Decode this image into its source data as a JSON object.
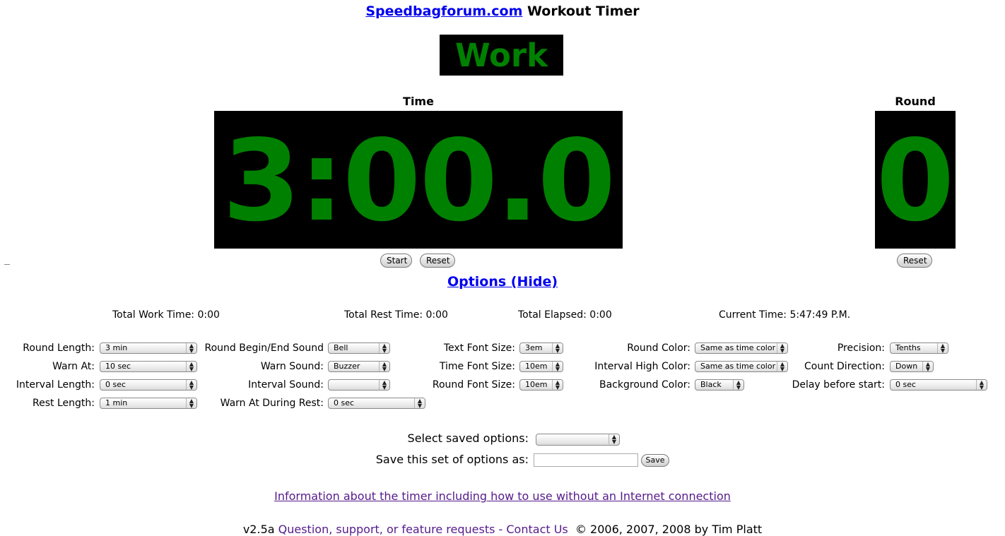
{
  "header": {
    "site_link": "Speedbagforum.com",
    "title_rest": " Workout Timer"
  },
  "mode_label": "Work",
  "time": {
    "heading": "Time",
    "value": "3:00.0",
    "start_label": "Start",
    "reset_label": "Reset"
  },
  "round": {
    "heading": "Round",
    "value": "0",
    "reset_label": "Reset"
  },
  "colors": {
    "display_bg": "#000000",
    "display_fg": "#008000",
    "link": "#0000ee",
    "visited_link": "#551a8b"
  },
  "options_link": "Options (Hide)",
  "stats": {
    "total_work": "Total Work Time: 0:00",
    "total_rest": "Total Rest Time: 0:00",
    "total_elapsed": "Total Elapsed: 0:00",
    "current_time": "Current Time: 5:47:49 P.M."
  },
  "options": {
    "round_length": {
      "label": "Round Length:",
      "value": "3 min"
    },
    "warn_at": {
      "label": "Warn At:",
      "value": "10 sec"
    },
    "interval_length": {
      "label": "Interval Length:",
      "value": "0 sec"
    },
    "rest_length": {
      "label": "Rest Length:",
      "value": "1 min"
    },
    "round_sound": {
      "label": "Round Begin/End Sound",
      "value": "Bell"
    },
    "warn_sound": {
      "label": "Warn Sound:",
      "value": "Buzzer"
    },
    "interval_sound": {
      "label": "Interval Sound:",
      "value": ""
    },
    "warn_during_rest": {
      "label": "Warn At During Rest:",
      "value": "0 sec"
    },
    "text_font_size": {
      "label": "Text Font Size:",
      "value": "3em"
    },
    "time_font_size": {
      "label": "Time Font Size:",
      "value": "10em"
    },
    "round_font_size": {
      "label": "Round Font Size:",
      "value": "10em"
    },
    "round_color": {
      "label": "Round Color:",
      "value": "Same as time color"
    },
    "interval_high_color": {
      "label": "Interval High Color:",
      "value": "Same as time color"
    },
    "background_color": {
      "label": "Background Color:",
      "value": "Black"
    },
    "precision": {
      "label": "Precision:",
      "value": "Tenths"
    },
    "count_direction": {
      "label": "Count Direction:",
      "value": "Down"
    },
    "delay_before_start": {
      "label": "Delay before start:",
      "value": "0 sec"
    }
  },
  "saved": {
    "select_label": "Select saved options:",
    "select_value": "",
    "save_as_label": "Save this set of options as:",
    "save_as_value": "",
    "save_button": "Save"
  },
  "info_link": "Information about the timer including how to use without an Internet connection",
  "footer": {
    "version": "v2.5a ",
    "contact_link": "Question, support, or feature requests - Contact Us",
    "copyright": "  © 2006, 2007, 2008 by Tim Platt"
  }
}
